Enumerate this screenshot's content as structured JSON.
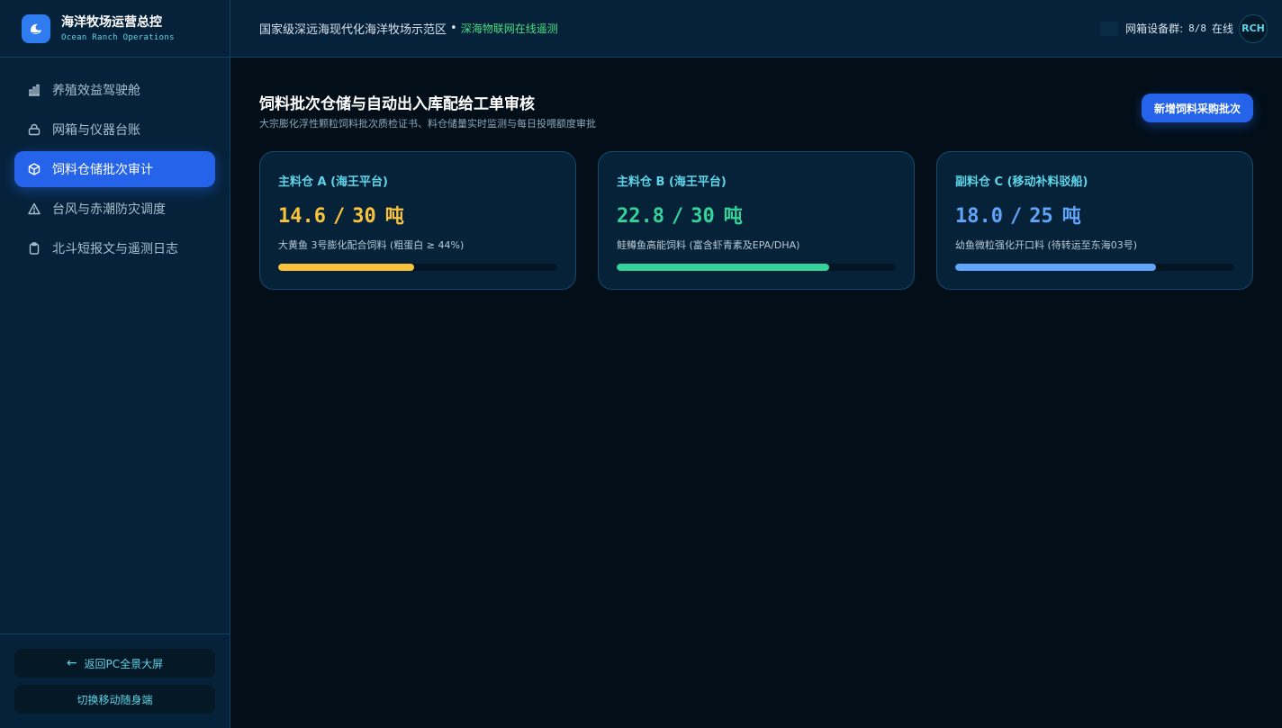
{
  "brand": {
    "title": "海洋牧场运营总控",
    "subtitle": "Ocean Ranch Operations"
  },
  "sidebar": {
    "items": [
      {
        "label": "养殖效益驾驶舱",
        "icon": "bar-chart-icon",
        "active": false
      },
      {
        "label": "网箱与仪器台账",
        "icon": "lock-icon",
        "active": false
      },
      {
        "label": "饲料仓储批次审计",
        "icon": "box-icon",
        "active": true
      },
      {
        "label": "台风与赤潮防灾调度",
        "icon": "warning-icon",
        "active": false
      },
      {
        "label": "北斗短报文与遥测日志",
        "icon": "clipboard-icon",
        "active": false
      }
    ],
    "footer": {
      "back_label": "返回PC全景大屏",
      "mobile_label": "切换移动随身端"
    }
  },
  "header": {
    "title": "国家级深远海现代化海洋牧场示范区",
    "dot": "•",
    "status": "深海物联网在线遥测",
    "device_label": "网箱设备群:",
    "device_count": "8/8",
    "device_state": "在线",
    "avatar": "RCH"
  },
  "page": {
    "title": "饲料批次仓储与自动出入库配给工单审核",
    "subtitle": "大宗膨化浮性颗粒饲料批次质检证书、料仓储量实时监测与每日投喂额度审批",
    "primary_button": "新增饲料采购批次"
  },
  "cards": [
    {
      "title": "主料仓 A (海王平台)",
      "current": "14.6",
      "capacity": "30",
      "separator": "/",
      "unit": "吨",
      "fill": 0.487,
      "color": "#f9c23c",
      "desc": "大黄鱼 3号膨化配合饲料 (粗蛋白 ≥ 44%)"
    },
    {
      "title": "主料仓 B (海王平台)",
      "current": "22.8",
      "capacity": "30",
      "separator": "/",
      "unit": "吨",
      "fill": 0.76,
      "color": "#34d399",
      "desc": "鲑鳟鱼高能饲料 (富含虾青素及EPA/DHA)"
    },
    {
      "title": "副料仓 C (移动补料驳船)",
      "current": "18.0",
      "capacity": "25",
      "separator": "/",
      "unit": "吨",
      "fill": 0.72,
      "color": "#60a5fa",
      "desc": "幼鱼微粒强化开口料 (待转运至东海03号)"
    }
  ]
}
